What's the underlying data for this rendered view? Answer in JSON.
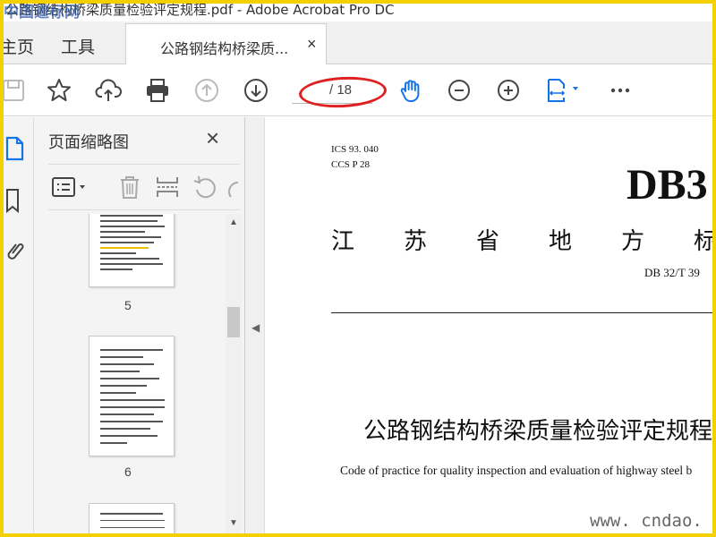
{
  "window": {
    "title": "公路钢结构桥梁质量检验评定规程.pdf - Adobe Acrobat Pro DC",
    "watermark_top": "中国道标网"
  },
  "tabs": {
    "home": "主页",
    "tools": "工具",
    "document": "公路钢结构桥梁质...",
    "close": "×"
  },
  "toolbar": {
    "page_total": "/ 18",
    "icons": [
      "save-icon",
      "bookmark-star-icon",
      "upload-cloud-icon",
      "print-icon",
      "page-up-icon",
      "page-down-icon",
      "hand-tool-icon",
      "zoom-out-icon",
      "zoom-in-icon",
      "fit-page-icon",
      "more-icon"
    ]
  },
  "thumbnails_panel": {
    "title": "页面缩略图",
    "close": "×",
    "pages": [
      "5",
      "6"
    ]
  },
  "document": {
    "ics": "ICS   93. 040",
    "ccs": "CCS   P 28",
    "db_mark": "DB3",
    "province": "江苏省地方标",
    "db_number": "DB 32/T  39",
    "title_cn": "公路钢结构桥梁质量检验评定规程",
    "title_en": "Code of practice for quality inspection and evaluation of highway steel b"
  },
  "watermark": "www. cndao. com",
  "colors": {
    "frame": "#f4d000",
    "accent_blue": "#1473e6",
    "annotation_red": "#e02020"
  }
}
